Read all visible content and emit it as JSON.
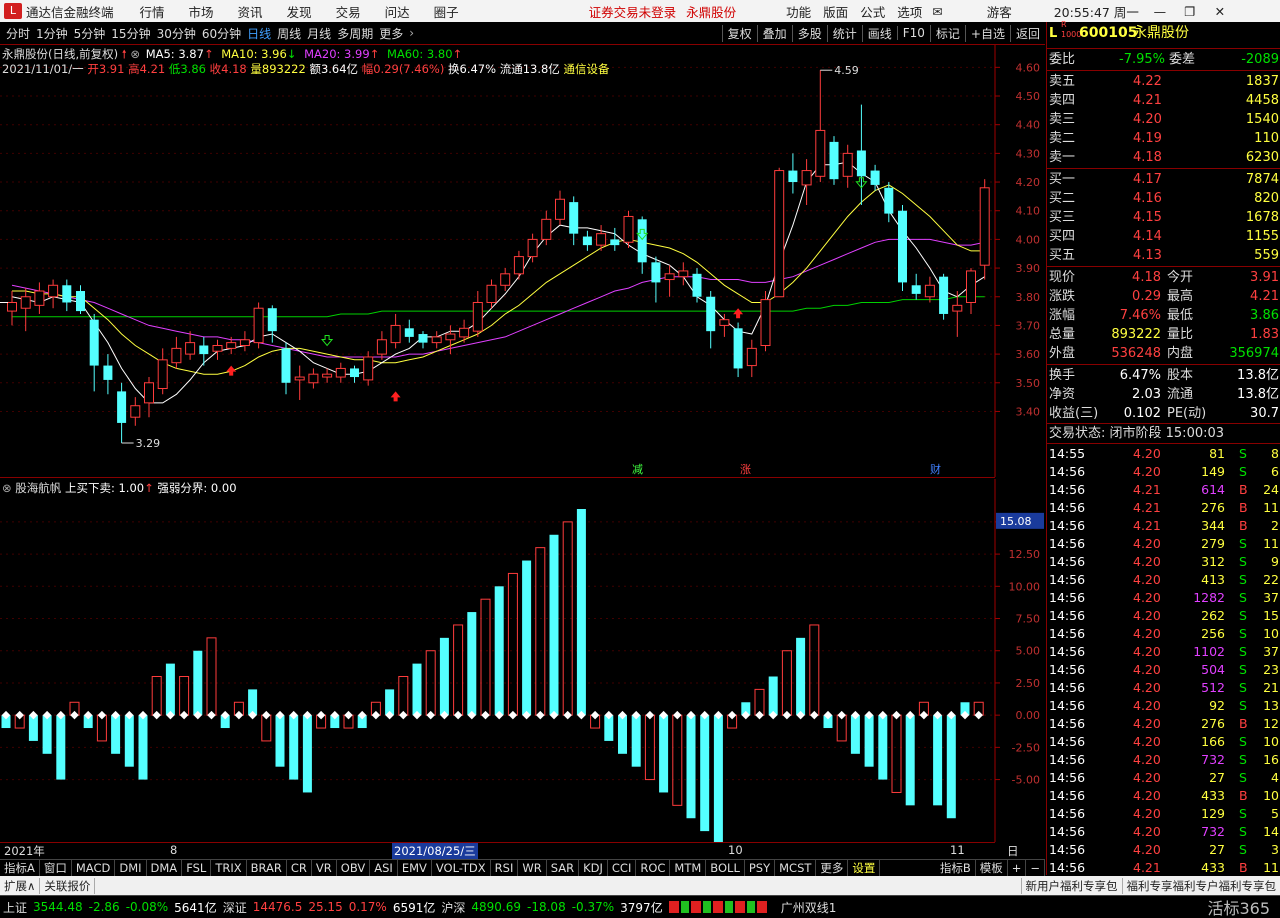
{
  "titlebar": {
    "app_name": "通达信金融终端",
    "menus": [
      "行情",
      "市场",
      "资讯",
      "发现",
      "交易",
      "问达",
      "圈子"
    ],
    "notice": "证券交易未登录",
    "stock_name": "永鼎股份",
    "right_menus": [
      "功能",
      "版面",
      "公式",
      "选项"
    ],
    "user": "游客",
    "clock": "20:55:47 周一"
  },
  "toolbar": {
    "periods": [
      "分时",
      "1分钟",
      "5分钟",
      "15分钟",
      "30分钟",
      "60分钟",
      "日线",
      "周线",
      "月线",
      "多周期",
      "更多"
    ],
    "active_period": "日线",
    "right_buttons": [
      "复权",
      "叠加",
      "多股",
      "统计",
      "画线",
      "F10",
      "标记",
      "+自选",
      "返回"
    ]
  },
  "main_chart": {
    "header_name": "永鼎股份(日线,前复权)",
    "ma5": "MA5: 3.87",
    "ma10": "MA10: 3.96",
    "ma20": "MA20: 3.99",
    "ma60": "MA60: 3.80",
    "info_date": "2021/11/01/一",
    "info_open": "开3.91",
    "info_high": "高4.21",
    "info_low": "低3.86",
    "info_close": "收4.18",
    "info_vol": "量893222",
    "info_amount": "额3.64亿",
    "info_range": "幅0.29(7.46%)",
    "info_turnover": "换6.47%",
    "info_float": "流通13.8亿",
    "info_industry": "通信设备",
    "max_label": "4.59",
    "min_label": "3.29",
    "marks": [
      "减",
      "涨",
      "财"
    ],
    "y_ticks": [
      "4.60",
      "4.50",
      "4.40",
      "4.30",
      "4.20",
      "4.10",
      "4.00",
      "3.90",
      "3.80",
      "3.70",
      "3.60",
      "3.50",
      "3.40"
    ]
  },
  "sub_chart": {
    "name": "股海航帆",
    "param1": "上买下卖: 1.00",
    "param2": "强弱分界: 0.00",
    "current_value": "15.08",
    "y_ticks": [
      "15.00",
      "12.50",
      "10.00",
      "7.50",
      "5.00",
      "2.50",
      "0.00",
      "-2.50",
      "-5.00"
    ]
  },
  "chart_data": {
    "type": "candlestick",
    "candles": [
      {
        "o": 3.75,
        "c": 3.78,
        "h": 3.82,
        "l": 3.7
      },
      {
        "o": 3.76,
        "c": 3.8,
        "h": 3.83,
        "l": 3.68
      },
      {
        "o": 3.77,
        "c": 3.82,
        "h": 3.85,
        "l": 3.74
      },
      {
        "o": 3.8,
        "c": 3.84,
        "h": 3.86,
        "l": 3.76
      },
      {
        "o": 3.84,
        "c": 3.78,
        "h": 3.86,
        "l": 3.75
      },
      {
        "o": 3.82,
        "c": 3.75,
        "h": 3.84,
        "l": 3.74
      },
      {
        "o": 3.72,
        "c": 3.56,
        "h": 3.74,
        "l": 3.47
      },
      {
        "o": 3.56,
        "c": 3.51,
        "h": 3.6,
        "l": 3.46
      },
      {
        "o": 3.47,
        "c": 3.36,
        "h": 3.5,
        "l": 3.29
      },
      {
        "o": 3.38,
        "c": 3.42,
        "h": 3.45,
        "l": 3.35
      },
      {
        "o": 3.43,
        "c": 3.5,
        "h": 3.52,
        "l": 3.38
      },
      {
        "o": 3.48,
        "c": 3.58,
        "h": 3.62,
        "l": 3.46
      },
      {
        "o": 3.57,
        "c": 3.62,
        "h": 3.66,
        "l": 3.55
      },
      {
        "o": 3.6,
        "c": 3.64,
        "h": 3.68,
        "l": 3.58
      },
      {
        "o": 3.63,
        "c": 3.6,
        "h": 3.66,
        "l": 3.56
      },
      {
        "o": 3.61,
        "c": 3.63,
        "h": 3.65,
        "l": 3.58
      },
      {
        "o": 3.62,
        "c": 3.64,
        "h": 3.66,
        "l": 3.6
      },
      {
        "o": 3.63,
        "c": 3.65,
        "h": 3.68,
        "l": 3.61
      },
      {
        "o": 3.64,
        "c": 3.76,
        "h": 3.78,
        "l": 3.62
      },
      {
        "o": 3.76,
        "c": 3.68,
        "h": 3.77,
        "l": 3.64
      },
      {
        "o": 3.62,
        "c": 3.5,
        "h": 3.64,
        "l": 3.46
      },
      {
        "o": 3.51,
        "c": 3.52,
        "h": 3.56,
        "l": 3.44
      },
      {
        "o": 3.5,
        "c": 3.53,
        "h": 3.55,
        "l": 3.48
      },
      {
        "o": 3.52,
        "c": 3.53,
        "h": 3.55,
        "l": 3.5
      },
      {
        "o": 3.52,
        "c": 3.55,
        "h": 3.57,
        "l": 3.5
      },
      {
        "o": 3.55,
        "c": 3.52,
        "h": 3.56,
        "l": 3.5
      },
      {
        "o": 3.51,
        "c": 3.59,
        "h": 3.61,
        "l": 3.49
      },
      {
        "o": 3.6,
        "c": 3.65,
        "h": 3.68,
        "l": 3.58
      },
      {
        "o": 3.64,
        "c": 3.7,
        "h": 3.74,
        "l": 3.62
      },
      {
        "o": 3.69,
        "c": 3.66,
        "h": 3.72,
        "l": 3.64
      },
      {
        "o": 3.67,
        "c": 3.64,
        "h": 3.68,
        "l": 3.62
      },
      {
        "o": 3.64,
        "c": 3.66,
        "h": 3.68,
        "l": 3.62
      },
      {
        "o": 3.65,
        "c": 3.67,
        "h": 3.7,
        "l": 3.6
      },
      {
        "o": 3.66,
        "c": 3.69,
        "h": 3.72,
        "l": 3.64
      },
      {
        "o": 3.68,
        "c": 3.78,
        "h": 3.82,
        "l": 3.66
      },
      {
        "o": 3.78,
        "c": 3.84,
        "h": 3.86,
        "l": 3.76
      },
      {
        "o": 3.84,
        "c": 3.88,
        "h": 3.9,
        "l": 3.82
      },
      {
        "o": 3.88,
        "c": 3.94,
        "h": 3.96,
        "l": 3.86
      },
      {
        "o": 3.94,
        "c": 4.0,
        "h": 4.02,
        "l": 3.92
      },
      {
        "o": 4.0,
        "c": 4.07,
        "h": 4.1,
        "l": 3.98
      },
      {
        "o": 4.07,
        "c": 4.14,
        "h": 4.17,
        "l": 4.05
      },
      {
        "o": 4.13,
        "c": 4.02,
        "h": 4.15,
        "l": 3.98
      },
      {
        "o": 4.01,
        "c": 3.98,
        "h": 4.03,
        "l": 3.96
      },
      {
        "o": 3.98,
        "c": 4.02,
        "h": 4.05,
        "l": 3.96
      },
      {
        "o": 4.0,
        "c": 3.98,
        "h": 4.04,
        "l": 3.96
      },
      {
        "o": 3.99,
        "c": 4.08,
        "h": 4.1,
        "l": 3.97
      },
      {
        "o": 4.07,
        "c": 3.92,
        "h": 4.08,
        "l": 3.88
      },
      {
        "o": 3.92,
        "c": 3.85,
        "h": 3.94,
        "l": 3.78
      },
      {
        "o": 3.86,
        "c": 3.88,
        "h": 3.91,
        "l": 3.8
      },
      {
        "o": 3.87,
        "c": 3.89,
        "h": 3.92,
        "l": 3.84
      },
      {
        "o": 3.88,
        "c": 3.8,
        "h": 3.9,
        "l": 3.78
      },
      {
        "o": 3.8,
        "c": 3.68,
        "h": 3.82,
        "l": 3.62
      },
      {
        "o": 3.7,
        "c": 3.72,
        "h": 3.74,
        "l": 3.66
      },
      {
        "o": 3.69,
        "c": 3.55,
        "h": 3.71,
        "l": 3.52
      },
      {
        "o": 3.56,
        "c": 3.62,
        "h": 3.65,
        "l": 3.52
      },
      {
        "o": 3.63,
        "c": 3.79,
        "h": 3.82,
        "l": 3.61
      },
      {
        "o": 3.8,
        "c": 4.24,
        "h": 4.25,
        "l": 3.8
      },
      {
        "o": 4.24,
        "c": 4.2,
        "h": 4.3,
        "l": 4.16
      },
      {
        "o": 4.19,
        "c": 4.24,
        "h": 4.28,
        "l": 4.12
      },
      {
        "o": 4.22,
        "c": 4.38,
        "h": 4.59,
        "l": 4.2
      },
      {
        "o": 4.34,
        "c": 4.21,
        "h": 4.36,
        "l": 4.19
      },
      {
        "o": 4.22,
        "c": 4.3,
        "h": 4.33,
        "l": 4.18
      },
      {
        "o": 4.31,
        "c": 4.22,
        "h": 4.47,
        "l": 4.12
      },
      {
        "o": 4.24,
        "c": 4.19,
        "h": 4.26,
        "l": 4.17
      },
      {
        "o": 4.18,
        "c": 4.09,
        "h": 4.2,
        "l": 4.06
      },
      {
        "o": 4.1,
        "c": 3.85,
        "h": 4.12,
        "l": 3.82
      },
      {
        "o": 3.84,
        "c": 3.81,
        "h": 3.88,
        "l": 3.79
      },
      {
        "o": 3.8,
        "c": 3.84,
        "h": 3.87,
        "l": 3.78
      },
      {
        "o": 3.87,
        "c": 3.74,
        "h": 3.88,
        "l": 3.72
      },
      {
        "o": 3.75,
        "c": 3.77,
        "h": 3.82,
        "l": 3.66
      },
      {
        "o": 3.78,
        "c": 3.89,
        "h": 3.9,
        "l": 3.74
      },
      {
        "o": 3.91,
        "c": 4.18,
        "h": 4.21,
        "l": 3.86
      }
    ],
    "ma5": [
      3.8,
      3.79,
      3.78,
      3.8,
      3.79,
      3.78,
      3.71,
      3.64,
      3.55,
      3.48,
      3.43,
      3.43,
      3.46,
      3.51,
      3.57,
      3.61,
      3.62,
      3.63,
      3.66,
      3.67,
      3.64,
      3.61,
      3.57,
      3.55,
      3.53,
      3.53,
      3.54,
      3.57,
      3.6,
      3.62,
      3.66,
      3.66,
      3.68,
      3.68,
      3.71,
      3.76,
      3.81,
      3.87,
      3.95,
      4.01,
      4.05,
      4.04,
      4.04,
      4.03,
      4.02,
      3.98,
      3.95,
      3.93,
      3.91,
      3.87,
      3.8,
      3.77,
      3.72,
      3.68,
      3.67,
      3.77,
      3.92,
      4.05,
      4.2,
      4.26,
      4.26,
      4.27,
      4.23,
      4.2,
      4.1,
      4.03,
      3.97,
      3.9,
      3.82,
      3.8,
      3.84,
      3.87
    ],
    "ma10": [
      3.82,
      3.82,
      3.81,
      3.81,
      3.8,
      3.8,
      3.76,
      3.72,
      3.67,
      3.63,
      3.6,
      3.57,
      3.55,
      3.54,
      3.53,
      3.53,
      3.54,
      3.56,
      3.59,
      3.61,
      3.62,
      3.62,
      3.61,
      3.6,
      3.59,
      3.58,
      3.58,
      3.57,
      3.57,
      3.58,
      3.59,
      3.61,
      3.63,
      3.65,
      3.67,
      3.7,
      3.74,
      3.77,
      3.81,
      3.85,
      3.88,
      3.91,
      3.94,
      3.97,
      3.99,
      4.0,
      3.99,
      3.98,
      3.97,
      3.95,
      3.92,
      3.88,
      3.84,
      3.81,
      3.78,
      3.78,
      3.81,
      3.85,
      3.9,
      3.96,
      4.02,
      4.08,
      4.13,
      4.17,
      4.19,
      4.16,
      4.12,
      4.08,
      4.03,
      3.98,
      3.96,
      3.96
    ],
    "ma20": [
      3.84,
      3.83,
      3.82,
      3.81,
      3.8,
      3.79,
      3.78,
      3.76,
      3.74,
      3.72,
      3.7,
      3.69,
      3.68,
      3.67,
      3.66,
      3.66,
      3.65,
      3.65,
      3.64,
      3.63,
      3.62,
      3.61,
      3.6,
      3.59,
      3.59,
      3.59,
      3.59,
      3.59,
      3.59,
      3.6,
      3.6,
      3.61,
      3.62,
      3.63,
      3.64,
      3.65,
      3.66,
      3.68,
      3.7,
      3.72,
      3.74,
      3.76,
      3.78,
      3.8,
      3.82,
      3.83,
      3.85,
      3.86,
      3.87,
      3.87,
      3.87,
      3.86,
      3.86,
      3.86,
      3.85,
      3.85,
      3.86,
      3.87,
      3.89,
      3.91,
      3.93,
      3.95,
      3.97,
      3.99,
      4.0,
      4.0,
      4.0,
      4.0,
      3.99,
      3.98,
      3.98,
      3.99
    ],
    "ma60": [
      3.73,
      3.73,
      3.73,
      3.73,
      3.73,
      3.73,
      3.73,
      3.73,
      3.73,
      3.73,
      3.73,
      3.73,
      3.73,
      3.73,
      3.73,
      3.73,
      3.73,
      3.73,
      3.73,
      3.73,
      3.73,
      3.73,
      3.73,
      3.73,
      3.74,
      3.74,
      3.74,
      3.75,
      3.75,
      3.75,
      3.75,
      3.75,
      3.75,
      3.75,
      3.75,
      3.75,
      3.75,
      3.75,
      3.75,
      3.75,
      3.75,
      3.75,
      3.75,
      3.75,
      3.75,
      3.75,
      3.75,
      3.75,
      3.75,
      3.75,
      3.75,
      3.75,
      3.75,
      3.75,
      3.75,
      3.75,
      3.75,
      3.75,
      3.76,
      3.76,
      3.77,
      3.77,
      3.78,
      3.78,
      3.78,
      3.79,
      3.79,
      3.79,
      3.79,
      3.8,
      3.8,
      3.8
    ],
    "indicator": [
      -1,
      -1,
      -2,
      -3,
      -5,
      1,
      -1,
      -2,
      -3,
      -4,
      -5,
      3,
      4,
      3,
      5,
      6,
      -1,
      1,
      2,
      -2,
      -4,
      -5,
      -6,
      -1,
      -1,
      -1,
      -1,
      1,
      2,
      3,
      4,
      5,
      6,
      7,
      8,
      9,
      10,
      11,
      12,
      13,
      14,
      15,
      16,
      -1,
      -2,
      -3,
      -4,
      -5,
      -6,
      -7,
      -8,
      -9,
      -10,
      -1,
      1,
      2,
      3,
      5,
      6,
      7,
      -1,
      -2,
      -3,
      -4,
      -5,
      -6,
      -7,
      1,
      -7,
      -8,
      1,
      1
    ],
    "y_range": [
      3.29,
      4.65
    ],
    "sub_y_range": [
      -10,
      16
    ]
  },
  "axis_dates": {
    "d1": "2021年",
    "d2": "8",
    "d3": "2021/08/25/三",
    "d4": "10",
    "d5": "11",
    "period_label": "日线"
  },
  "quote": {
    "code": "600105",
    "name": "永鼎股份",
    "ratio_label": "委比",
    "ratio": "-7.95%",
    "diff_label": "委差",
    "diff": "-2089",
    "asks": [
      {
        "label": "卖五",
        "price": "4.22",
        "vol": "1837"
      },
      {
        "label": "卖四",
        "price": "4.21",
        "vol": "4458"
      },
      {
        "label": "卖三",
        "price": "4.20",
        "vol": "1540"
      },
      {
        "label": "卖二",
        "price": "4.19",
        "vol": "110"
      },
      {
        "label": "卖一",
        "price": "4.18",
        "vol": "6230"
      }
    ],
    "bids": [
      {
        "label": "买一",
        "price": "4.17",
        "vol": "7874"
      },
      {
        "label": "买二",
        "price": "4.16",
        "vol": "820"
      },
      {
        "label": "买三",
        "price": "4.15",
        "vol": "1678"
      },
      {
        "label": "买四",
        "price": "4.14",
        "vol": "1155"
      },
      {
        "label": "买五",
        "price": "4.13",
        "vol": "559"
      }
    ],
    "stats": [
      {
        "l1": "现价",
        "v1": "4.18",
        "l2": "今开",
        "v2": "3.91"
      },
      {
        "l1": "涨跌",
        "v1": "0.29",
        "l2": "最高",
        "v2": "4.21"
      },
      {
        "l1": "涨幅",
        "v1": "7.46%",
        "l2": "最低",
        "v2": "3.86"
      },
      {
        "l1": "总量",
        "v1": "893222",
        "l2": "量比",
        "v2": "1.83"
      },
      {
        "l1": "外盘",
        "v1": "536248",
        "l2": "内盘",
        "v2": "356974"
      }
    ],
    "stats2": [
      {
        "l1": "换手",
        "v1": "6.47%",
        "l2": "股本",
        "v2": "13.8亿"
      },
      {
        "l1": "净资",
        "v1": "2.03",
        "l2": "流通",
        "v2": "13.8亿"
      },
      {
        "l1": "收益(三)",
        "v1": "0.102",
        "l2": "PE(动)",
        "v2": "30.7"
      }
    ],
    "trade_status": "交易状态: 闭市阶段 15:00:03"
  },
  "ticks": [
    {
      "t": "14:55",
      "p": "4.20",
      "v": "81",
      "s": "S",
      "n": "8"
    },
    {
      "t": "14:56",
      "p": "4.20",
      "v": "149",
      "s": "S",
      "n": "6"
    },
    {
      "t": "14:56",
      "p": "4.21",
      "v": "614",
      "s": "B",
      "n": "24"
    },
    {
      "t": "14:56",
      "p": "4.21",
      "v": "276",
      "s": "B",
      "n": "11"
    },
    {
      "t": "14:56",
      "p": "4.21",
      "v": "344",
      "s": "B",
      "n": "2"
    },
    {
      "t": "14:56",
      "p": "4.20",
      "v": "279",
      "s": "S",
      "n": "11"
    },
    {
      "t": "14:56",
      "p": "4.20",
      "v": "312",
      "s": "S",
      "n": "9"
    },
    {
      "t": "14:56",
      "p": "4.20",
      "v": "413",
      "s": "S",
      "n": "22"
    },
    {
      "t": "14:56",
      "p": "4.20",
      "v": "1282",
      "s": "S",
      "n": "37"
    },
    {
      "t": "14:56",
      "p": "4.20",
      "v": "262",
      "s": "S",
      "n": "15"
    },
    {
      "t": "14:56",
      "p": "4.20",
      "v": "256",
      "s": "S",
      "n": "10"
    },
    {
      "t": "14:56",
      "p": "4.20",
      "v": "1102",
      "s": "S",
      "n": "37"
    },
    {
      "t": "14:56",
      "p": "4.20",
      "v": "504",
      "s": "S",
      "n": "23"
    },
    {
      "t": "14:56",
      "p": "4.20",
      "v": "512",
      "s": "S",
      "n": "21"
    },
    {
      "t": "14:56",
      "p": "4.20",
      "v": "92",
      "s": "S",
      "n": "13"
    },
    {
      "t": "14:56",
      "p": "4.20",
      "v": "276",
      "s": "B",
      "n": "12"
    },
    {
      "t": "14:56",
      "p": "4.20",
      "v": "166",
      "s": "S",
      "n": "10"
    },
    {
      "t": "14:56",
      "p": "4.20",
      "v": "732",
      "s": "S",
      "n": "16"
    },
    {
      "t": "14:56",
      "p": "4.20",
      "v": "27",
      "s": "S",
      "n": "4"
    },
    {
      "t": "14:56",
      "p": "4.20",
      "v": "433",
      "s": "B",
      "n": "10"
    },
    {
      "t": "14:56",
      "p": "4.20",
      "v": "129",
      "s": "S",
      "n": "5"
    },
    {
      "t": "14:56",
      "p": "4.20",
      "v": "732",
      "s": "S",
      "n": "14"
    },
    {
      "t": "14:56",
      "p": "4.20",
      "v": "27",
      "s": "S",
      "n": "3"
    },
    {
      "t": "14:56",
      "p": "4.21",
      "v": "433",
      "s": "B",
      "n": "11"
    }
  ],
  "tabs": {
    "items": [
      "指标A",
      "窗口",
      "MACD",
      "DMI",
      "DMA",
      "FSL",
      "TRIX",
      "BRAR",
      "CR",
      "VR",
      "OBV",
      "ASI",
      "EMV",
      "VOL-TDX",
      "RSI",
      "WR",
      "SAR",
      "KDJ",
      "CCI",
      "ROC",
      "MTM",
      "BOLL",
      "PSY",
      "MCST",
      "更多",
      "设置"
    ],
    "right": [
      "指标B",
      "模板",
      "+",
      "−"
    ]
  },
  "tabs2": {
    "left": [
      "扩展∧",
      "关联报价"
    ],
    "right": [
      "新用户福利专享包",
      "福利专享福利专户福利专享包"
    ]
  },
  "status": {
    "sh_label": "上证",
    "sh_val": "3544.48",
    "sh_chg": "-2.86",
    "sh_pct": "-0.08%",
    "sh_amt": "5641亿",
    "sz_label": "深证",
    "sz_val": "14476.5",
    "sz_chg": "25.15",
    "sz_pct": "0.17%",
    "sz_amt": "6591亿",
    "hs_label": "沪深",
    "hs_val": "4890.69",
    "hs_chg": "-18.08",
    "hs_pct": "-0.37%",
    "hs_amt": "3797亿",
    "server": "广州双线1",
    "brand": "活标365"
  }
}
